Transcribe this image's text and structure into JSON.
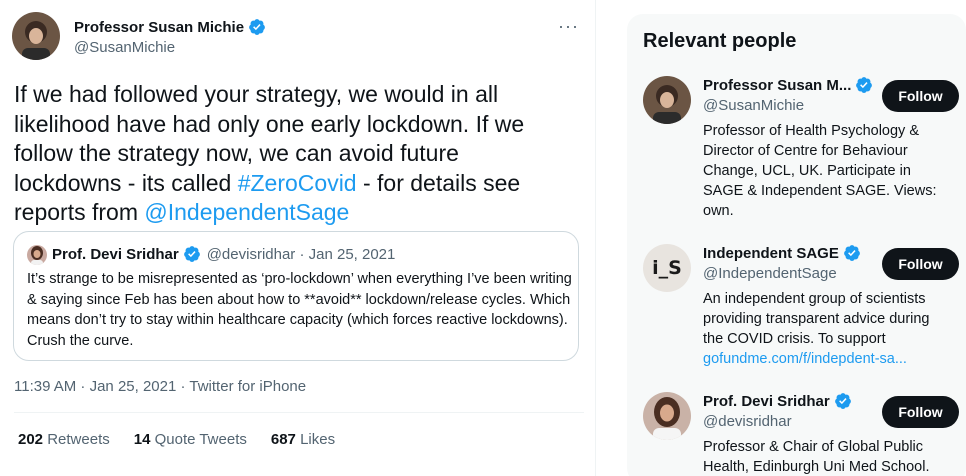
{
  "tweet": {
    "author_name": "Professor Susan Michie",
    "author_handle": "@SusanMichie",
    "more_label": "···",
    "text_lines": [
      "If we had followed your strategy, we would in all",
      "likelihood have had only one early lockdown. If we",
      "follow the strategy now, we can avoid future",
      "lockdowns - its called "
    ],
    "hashtag": "#ZeroCovid",
    "text_after_hashtag": " - for details see",
    "text_line5_prefix": "reports from ",
    "mention": "@IndependentSage",
    "timestamp": "11:39 AM · Jan 25, 2021 · Twitter for iPhone",
    "stats": [
      {
        "count": "202",
        "label": "Retweets"
      },
      {
        "count": "14",
        "label": "Quote Tweets"
      },
      {
        "count": "687",
        "label": "Likes"
      }
    ]
  },
  "quote": {
    "name": "Prof. Devi Sridhar",
    "meta": "@devisridhar · Jan 25, 2021",
    "text": "It’s strange to be misrepresented as ‘pro-lockdown’ when everything I’ve been writing & saying since Feb has been about how to **avoid** lockdown/release cycles. Which means don’t try to stay within healthcare capacity (which forces reactive lockdowns). Crush the curve."
  },
  "sidebar": {
    "title": "Relevant people",
    "people": [
      {
        "name": "Professor Susan M...",
        "handle": "@SusanMichie",
        "bio": "Professor of Health Psychology & Director of Centre for Behaviour Change, UCL, UK. Participate in SAGE & Independent SAGE. Views: own.",
        "bio_link": "",
        "follow_label": "Follow"
      },
      {
        "name": "Independent SAGE",
        "handle": "@IndependentSage",
        "bio": "An independent group of scientists providing transparent advice during the COVID crisis. To support ",
        "bio_link": "gofundme.com/f/indepdent-sa...",
        "follow_label": "Follow",
        "avatar_text": "i_S"
      },
      {
        "name": "Prof. Devi Sridhar",
        "handle": "@devisridhar",
        "bio": "Professor & Chair of Global Public Health, Edinburgh Uni Med School.",
        "bio_link": "",
        "follow_label": "Follow"
      }
    ]
  },
  "colors": {
    "accent": "#1d9bf0",
    "text": "#0f1419",
    "secondary": "#536471",
    "button_bg": "#0f1419",
    "sidebar_bg": "#f7f9f9"
  }
}
